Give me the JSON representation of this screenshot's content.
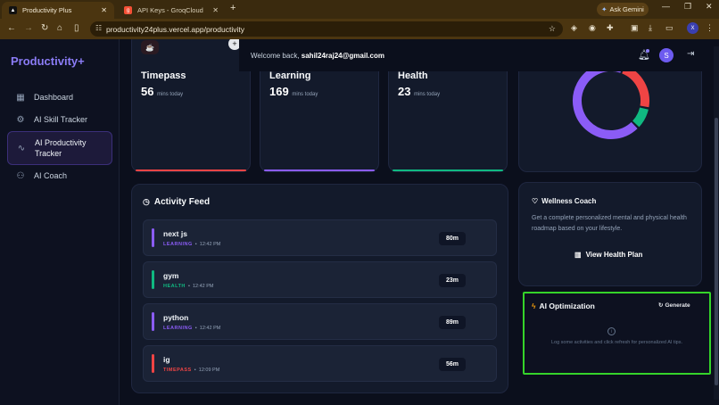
{
  "browser": {
    "tabs": [
      {
        "title": "Productivity Plus",
        "active": true
      },
      {
        "title": "API Keys - GroqCloud",
        "active": false
      }
    ],
    "new_tab": "+",
    "gemini_label": "Ask Gemini",
    "url": "productivity24plus.vercel.app/productivity",
    "profile_initial": "X"
  },
  "sidebar": {
    "brand": "Productivity+",
    "items": [
      {
        "label": "Dashboard",
        "icon": "grid-icon"
      },
      {
        "label": "AI Skill Tracker",
        "icon": "gear-icon"
      },
      {
        "label": "AI Productivity Tracker",
        "icon": "activity-icon",
        "active": true
      },
      {
        "label": "AI Coach",
        "icon": "users-icon"
      }
    ]
  },
  "topbar": {
    "welcome_prefix": "Welcome back,",
    "email": "sahil24raj24@gmail.com",
    "user_initial": "S"
  },
  "stats": [
    {
      "label": "Timepass",
      "value": "56",
      "unit": "mins today",
      "color": "#ef4444"
    },
    {
      "label": "Learning",
      "value": "169",
      "unit": "mins today",
      "color": "#8b5cf6"
    },
    {
      "label": "Health",
      "value": "23",
      "unit": "mins today",
      "color": "#10b981"
    }
  ],
  "donut": {
    "segments": [
      {
        "category": "LEARNING",
        "value": 169,
        "color": "#8b5cf6"
      },
      {
        "category": "TIMEPASS",
        "value": 56,
        "color": "#ef4444"
      },
      {
        "category": "HEALTH",
        "value": 23,
        "color": "#10b981"
      }
    ]
  },
  "feed": {
    "title": "Activity Feed",
    "items": [
      {
        "name": "next js",
        "category": "LEARNING",
        "time": "12:42 PM",
        "duration": "80m",
        "color": "#8b5cf6"
      },
      {
        "name": "gym",
        "category": "HEALTH",
        "time": "12:42 PM",
        "duration": "23m",
        "color": "#10b981"
      },
      {
        "name": "python",
        "category": "LEARNING",
        "time": "12:42 PM",
        "duration": "89m",
        "color": "#8b5cf6"
      },
      {
        "name": "ig",
        "category": "TIMEPASS",
        "time": "12:09 PM",
        "duration": "56m",
        "color": "#ef4444"
      }
    ]
  },
  "wellness": {
    "title": "Wellness Coach",
    "text": "Get a complete personalized mental and physical health roadmap based on your lifestyle.",
    "button": "View Health Plan"
  },
  "ai_optimization": {
    "title": "AI Optimization",
    "button": "Generate",
    "message": "Log some activities and click refresh for personalized AI tips."
  },
  "colors": {
    "accent": "#8b7cf6",
    "highlight_border": "#35d42a"
  }
}
